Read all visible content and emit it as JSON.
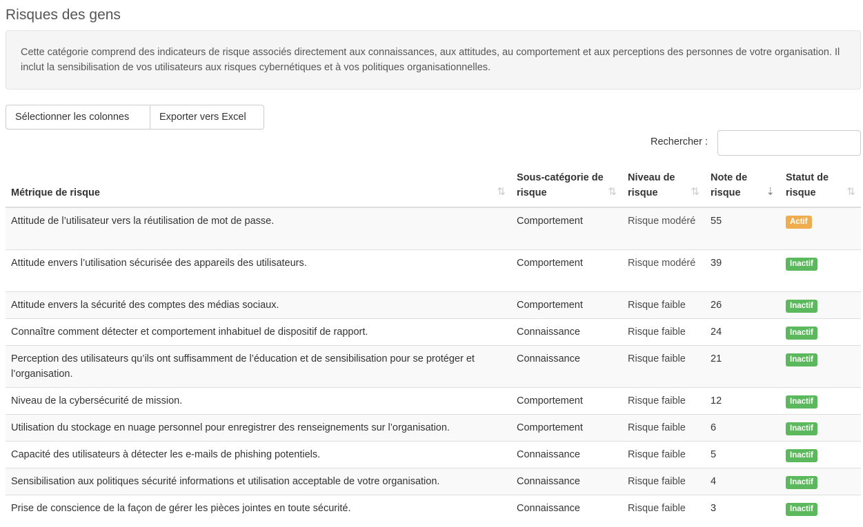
{
  "page": {
    "title": "Risques des gens",
    "description": "Cette catégorie comprend des indicateurs de risque associés directement aux connaissances, aux attitudes, au comportement et aux perceptions des personnes de votre organisation. Il inclut la sensibilisation de vos utilisateurs aux risques cybernétiques et à vos politiques organisationnelles."
  },
  "toolbar": {
    "select_columns_label": "Sélectionner les colonnes",
    "export_label": "Exporter vers Excel"
  },
  "search": {
    "label": "Rechercher :",
    "value": ""
  },
  "colors": {
    "badge_active": "#f0ad4e",
    "badge_inactive": "#5cb85c",
    "level_moderate": "#8a6d3b",
    "level_low": "#3c763d"
  },
  "table": {
    "columns": [
      {
        "label": "Métrique de risque",
        "sort": "none"
      },
      {
        "label": "Sous-catégorie de risque",
        "sort": "none"
      },
      {
        "label": "Niveau de risque",
        "sort": "none"
      },
      {
        "label": "Note de risque",
        "sort": "descending"
      },
      {
        "label": "Statut de risque",
        "sort": "none"
      }
    ],
    "rows": [
      {
        "metric": "Attitude de l’utilisateur vers la réutilisation de mot de passe.",
        "subcategory": "Comportement",
        "level": "Risque modéré",
        "level_type": "moderate",
        "score": "55",
        "status": "Actif",
        "status_type": "active"
      },
      {
        "metric": "Attitude envers l’utilisation sécurisée des appareils des utilisateurs.",
        "subcategory": "Comportement",
        "level": "Risque modéré",
        "level_type": "moderate",
        "score": "39",
        "status": "Inactif",
        "status_type": "inactive"
      },
      {
        "metric": "Attitude envers la sécurité des comptes des médias sociaux.",
        "subcategory": "Comportement",
        "level": "Risque faible",
        "level_type": "low",
        "score": "26",
        "status": "Inactif",
        "status_type": "inactive"
      },
      {
        "metric": "Connaître comment détecter et comportement inhabituel de dispositif de rapport.",
        "subcategory": "Connaissance",
        "level": "Risque faible",
        "level_type": "low",
        "score": "24",
        "status": "Inactif",
        "status_type": "inactive"
      },
      {
        "metric": "Perception des utilisateurs qu’ils ont suffisamment de l’éducation et de sensibilisation pour se protéger et l’organisation.",
        "subcategory": "Connaissance",
        "level": "Risque faible",
        "level_type": "low",
        "score": "21",
        "status": "Inactif",
        "status_type": "inactive"
      },
      {
        "metric": "Niveau de la cybersécurité de mission.",
        "subcategory": "Comportement",
        "level": "Risque faible",
        "level_type": "low",
        "score": "12",
        "status": "Inactif",
        "status_type": "inactive"
      },
      {
        "metric": "Utilisation du stockage en nuage personnel pour enregistrer des renseignements sur l’organisation.",
        "subcategory": "Comportement",
        "level": "Risque faible",
        "level_type": "low",
        "score": "6",
        "status": "Inactif",
        "status_type": "inactive"
      },
      {
        "metric": "Capacité des utilisateurs à détecter les e-mails de phishing potentiels.",
        "subcategory": "Connaissance",
        "level": "Risque faible",
        "level_type": "low",
        "score": "5",
        "status": "Inactif",
        "status_type": "inactive"
      },
      {
        "metric": "Sensibilisation aux politiques sécurité informations et utilisation acceptable de votre organisation.",
        "subcategory": "Connaissance",
        "level": "Risque faible",
        "level_type": "low",
        "score": "4",
        "status": "Inactif",
        "status_type": "inactive"
      },
      {
        "metric": "Prise de conscience de la façon de gérer les pièces jointes en toute sécurité.",
        "subcategory": "Connaissance",
        "level": "Risque faible",
        "level_type": "low",
        "score": "3",
        "status": "Inactif",
        "status_type": "inactive"
      }
    ]
  }
}
